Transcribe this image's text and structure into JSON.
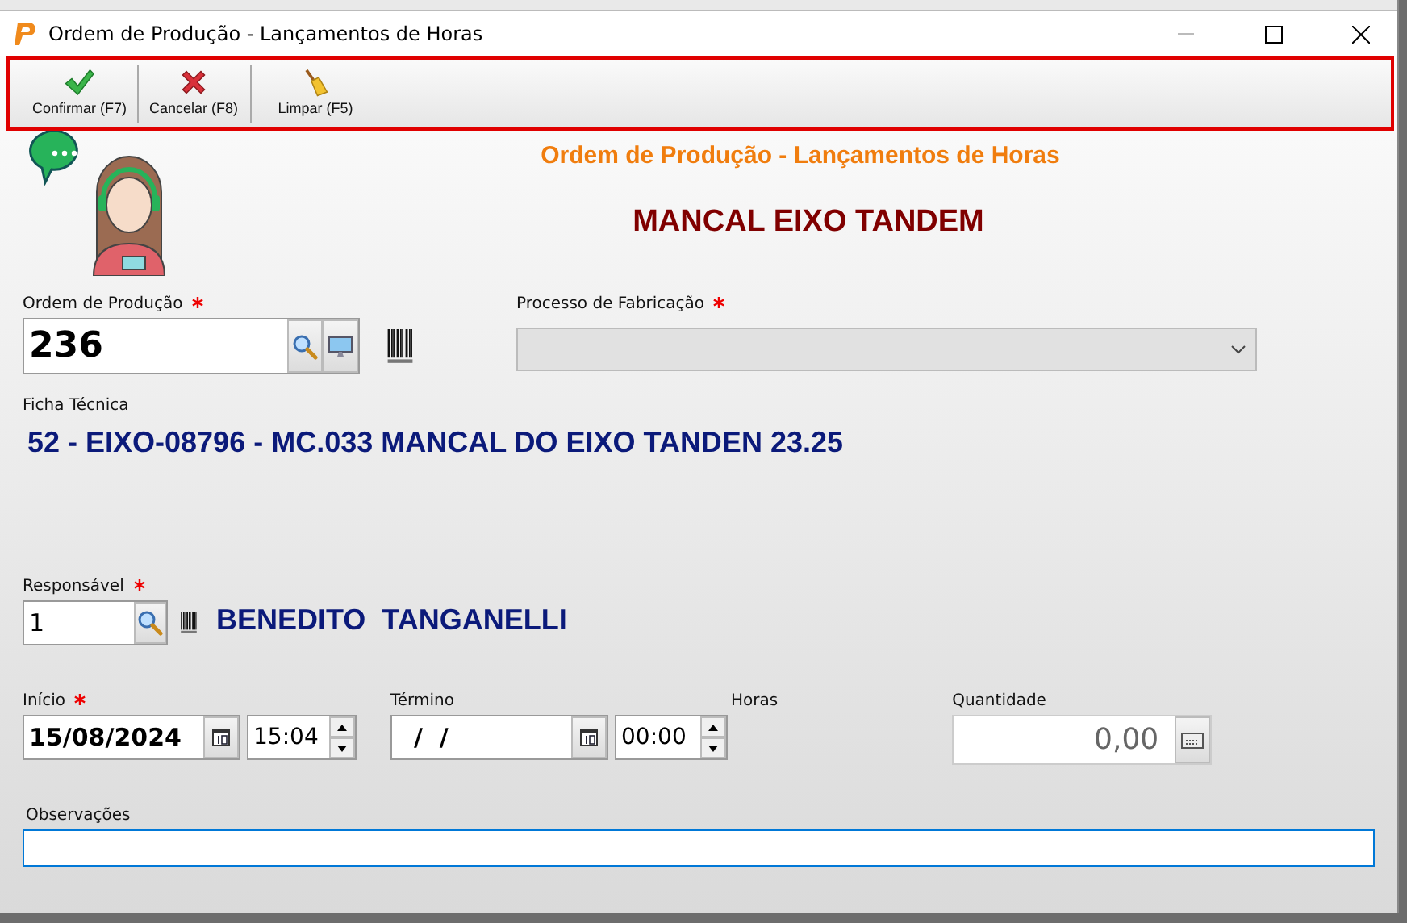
{
  "window": {
    "title": "Ordem de Produção - Lançamentos de Horas"
  },
  "toolbar": [
    {
      "label": "Confirmar (F7)",
      "kind": "confirm"
    },
    {
      "label": "Cancelar (F8)",
      "kind": "cancel"
    },
    {
      "label": "Limpar (F5)",
      "kind": "clear"
    }
  ],
  "form": {
    "title": "Ordem de Produção - Lançamentos de Horas",
    "product": "MANCAL EIXO TANDEM",
    "production_order": {
      "label": "Ordem de Produção",
      "required": true,
      "value": "236"
    },
    "process": {
      "label": "Processo de Fabricação",
      "required": true,
      "disabled": true
    },
    "technical_sheet": {
      "label": "Ficha Técnica",
      "value": "52 - EIXO-08796 - MC.033 MANCAL DO EIXO TANDEN 23.25"
    },
    "responsible": {
      "label": "Responsável",
      "required": true,
      "value": "1",
      "name": "BENEDITO  TANGANELLI"
    },
    "start": {
      "label": "Início",
      "required": true,
      "date": "15/08/2024",
      "time": "15:04"
    },
    "end": {
      "label": "Término",
      "date": "/  /",
      "time": "00:00"
    },
    "hours": {
      "label": "Horas"
    },
    "quantity": {
      "label": "Quantidade",
      "value": "0,00"
    },
    "notes": {
      "label": "Observações",
      "focused": true
    }
  }
}
